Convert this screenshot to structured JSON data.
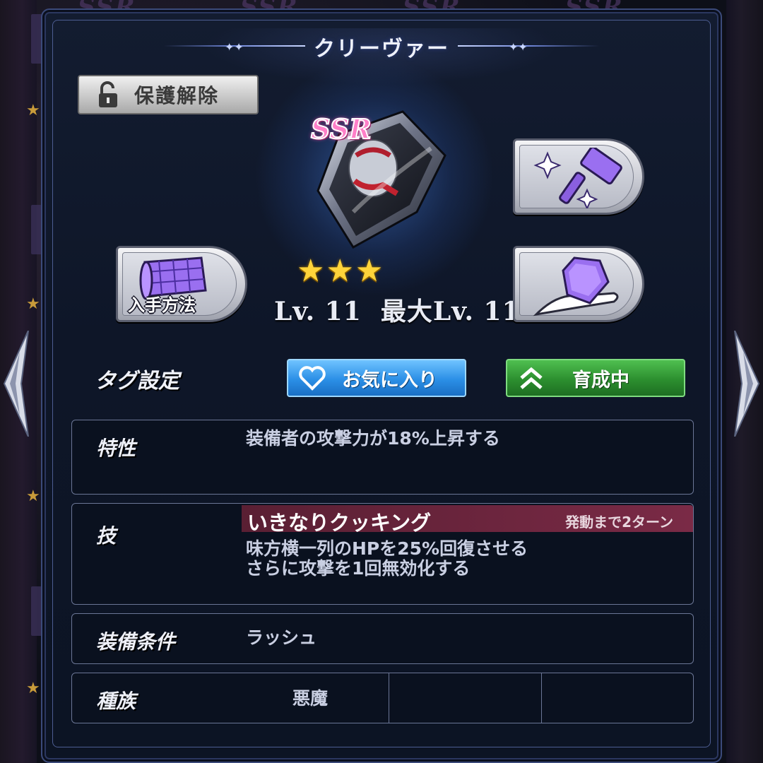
{
  "item": {
    "name": "クリーヴァー",
    "rarity": "SSR",
    "stars": 3,
    "level_text": "Lv. 11",
    "max_level_text": "最大Lv. 11"
  },
  "buttons": {
    "unlock": "保護解除",
    "obtain_method": "入手方法",
    "favorite": "お気に入り",
    "training": "育成中"
  },
  "tag": {
    "label": "タグ設定"
  },
  "trait": {
    "label": "特性",
    "text": "装備者の攻撃力が18%上昇する"
  },
  "skill": {
    "label": "技",
    "name": "いきなりクッキング",
    "turns": "発動まで2ターン",
    "line1": "味方横一列のHPを25%回復させる",
    "line2": "さらに攻撃を1回無効化する"
  },
  "equip": {
    "label": "装備条件",
    "value": "ラッシュ"
  },
  "race": {
    "label": "種族",
    "value": "悪魔"
  },
  "background": {
    "faded_text": "SSR"
  },
  "icons": [
    "lock-open-icon",
    "map-scroll-icon",
    "hammer-sparkle-icon",
    "gem-hand-icon",
    "heart-icon",
    "chevron-up-double-icon",
    "arrow-left-icon",
    "arrow-right-icon",
    "star-icon"
  ],
  "colors": {
    "panel": "#0e1628",
    "favorite": "#2b8fe6",
    "training": "#2c8f2f",
    "skill_header": "#6b2540",
    "ssr": "#ff7fc8",
    "star": "#ffd43a"
  }
}
